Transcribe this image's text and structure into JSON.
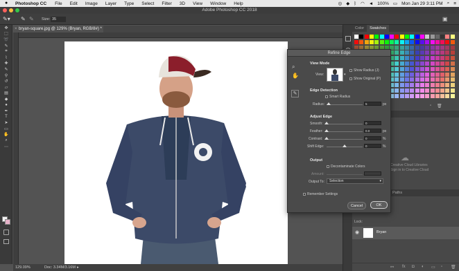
{
  "menubar": {
    "app": "Photoshop CC",
    "items": [
      "File",
      "Edit",
      "Image",
      "Layer",
      "Type",
      "Select",
      "Filter",
      "3D",
      "View",
      "Window",
      "Help"
    ],
    "battery": "100%",
    "clock": "Mon Jan 29  3:11 PM"
  },
  "window": {
    "title": "Adobe Photoshop CC 2018"
  },
  "options": {
    "size_label": "Size:",
    "size_value": "35"
  },
  "document": {
    "tab": "bryan-square.jpg @ 129% (Bryan, RGB/8#) *",
    "zoom": "129.09%",
    "doc_info": "Doc: 3.34M/3.16M"
  },
  "panels": {
    "color_tab": "Color",
    "swatches_tab": "Swatches",
    "cc_line1": "Creative Cloud Libraries",
    "cc_line2": "Sign in to Creative Cloud",
    "paths_tab": "Paths",
    "lock_label": "Lock:",
    "layer_name": "Bryan"
  },
  "dialog": {
    "title": "Refine Edge",
    "view_mode": "View Mode",
    "view_label": "View:",
    "show_radius": "Show Radius (J)",
    "show_original": "Show Original (P)",
    "edge_detection": "Edge Detection",
    "smart_radius": "Smart Radius",
    "radius_label": "Radius:",
    "radius_value": "5",
    "radius_unit": "px",
    "adjust_edge": "Adjust Edge",
    "smooth_label": "Smooth:",
    "smooth_value": "0",
    "feather_label": "Feather:",
    "feather_value": "0.0",
    "feather_unit": "px",
    "contrast_label": "Contrast:",
    "contrast_value": "0",
    "contrast_unit": "%",
    "shift_label": "Shift Edge:",
    "shift_value": "0",
    "shift_unit": "%",
    "output": "Output",
    "decontaminate": "Decontaminate Colors",
    "amount_label": "Amount:",
    "output_to_label": "Output To:",
    "output_to_value": "Selection",
    "remember": "Remember Settings",
    "cancel": "Cancel",
    "ok": "OK"
  },
  "colors": {
    "accent": "#2d7fd3"
  }
}
